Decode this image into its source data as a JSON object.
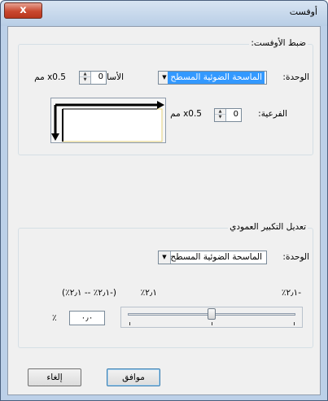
{
  "window": {
    "title": "أوفست",
    "close_label": "x"
  },
  "offset_group": {
    "legend": "ضبط الأوفست:",
    "unit_label": "الوحدة:",
    "unit_value": "الماسحة الضوئية المسطح",
    "primary_label": "الأساسية:",
    "primary_value": "0",
    "primary_suffix": "x0.5 مم",
    "secondary_label": "الفرعية:",
    "secondary_value": "0",
    "secondary_suffix": "x0.5 مم"
  },
  "scale_group": {
    "legend": "تعديل التكبير العمودي",
    "unit_label": "الوحدة:",
    "unit_value": "الماسحة الضوئية المسطح",
    "min_label": "-٢٫١٪",
    "max_label": "٢٫١٪",
    "range_label": "(-٢٫١٪ -- ٢٫١٪)",
    "percent_value": "٠٫٠",
    "percent_sign": "٪",
    "slider_fraction": 0.5
  },
  "buttons": {
    "ok": "موافق",
    "cancel": "إلغاء"
  }
}
